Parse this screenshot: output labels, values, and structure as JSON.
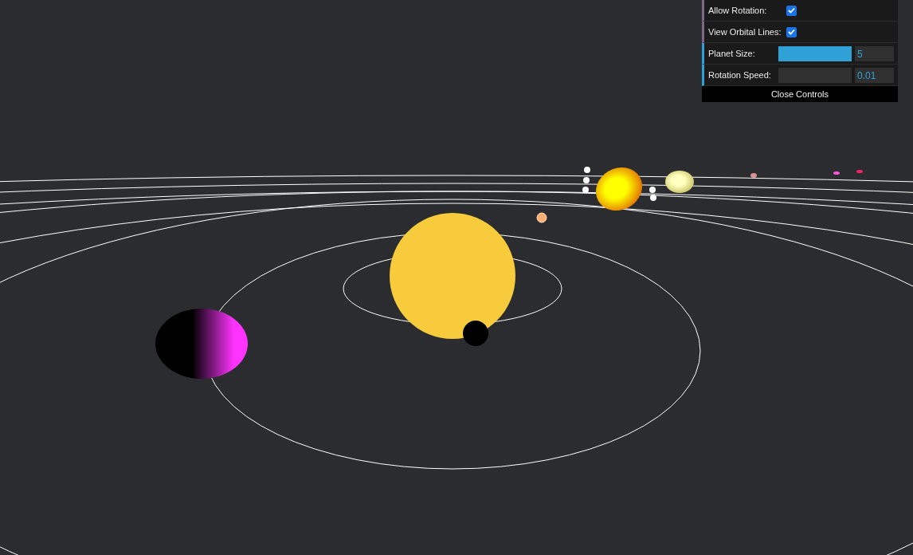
{
  "controls": [
    {
      "kind": "checkbox",
      "label": "Allow Rotation:",
      "checked": true
    },
    {
      "kind": "checkbox",
      "label": "View Orbital Lines:",
      "checked": true
    },
    {
      "kind": "slider",
      "label": "Planet Size:",
      "level": 1,
      "value": "5"
    },
    {
      "kind": "slider",
      "label": "Rotation Speed:",
      "level": 0,
      "value": "0.01"
    }
  ],
  "close_button": "Close Controls"
}
